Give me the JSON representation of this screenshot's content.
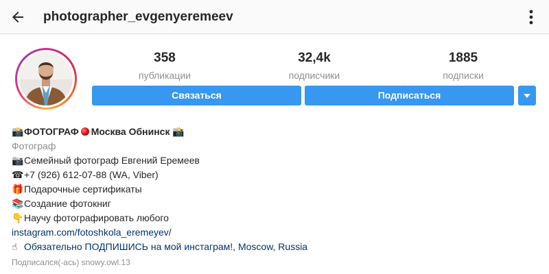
{
  "header": {
    "username": "photographer_evgenyeremeev",
    "back_icon": "arrow-left-icon",
    "more_icon": "more-vertical-icon"
  },
  "stats": [
    {
      "value": "358",
      "label": "публикации"
    },
    {
      "value": "32,4k",
      "label": "подписчики"
    },
    {
      "value": "1885",
      "label": "подписки"
    }
  ],
  "buttons": {
    "contact": "Связаться",
    "follow": "Подписаться",
    "dropdown_icon": "caret-down-icon"
  },
  "colors": {
    "accent": "#3897f0",
    "link": "#003569",
    "secondary_text": "#8e8e8e"
  },
  "bio": {
    "name_prefix_emoji": "📸",
    "name_title": "ФОТОГРАФ",
    "name_city": "Москва Обнинск",
    "name_suffix_emoji": "📸",
    "category": "Фотограф",
    "lines": [
      {
        "emoji": "📷",
        "text": "Семейный фотограф Евгений Еремеев"
      },
      {
        "emoji": "☎",
        "text": "+7 (926) 612-07-88 (WA, Viber)"
      },
      {
        "emoji": "🎁",
        "text": "Подарочные сертификаты"
      },
      {
        "emoji": "📚",
        "text": "Создание фотокниг"
      },
      {
        "emoji": "👇",
        "text": "Научу фотографировать любого"
      }
    ],
    "link": "instagram.com/fotoshkola_eremeyev/",
    "cta_emoji": "☝",
    "cta_text": "Обязательно ПОДПИШИСЬ на мой инстаграм!",
    "location_sep": ", ",
    "location": "Moscow, Russia",
    "followed_by": "Подписался(-ась) snowy.owl.13"
  }
}
